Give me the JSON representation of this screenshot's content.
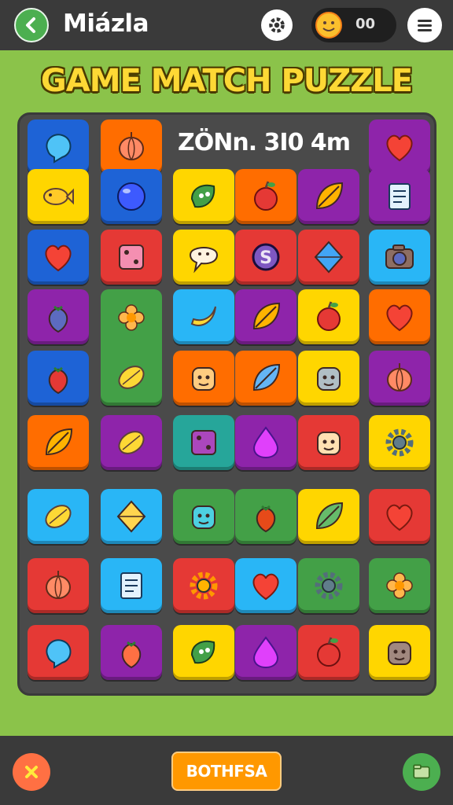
{
  "header": {
    "app_title": "Miázla",
    "coin_count": "00",
    "icons": [
      "back-arrow-icon",
      "gear-icon",
      "coin-face-icon",
      "hamburger-menu-icon"
    ]
  },
  "game": {
    "title": "GAME MATCH PUZZLE",
    "stats_text": "ZÖNn. 3I0  4m"
  },
  "footer": {
    "action_label": "BOTHFSA",
    "icons": [
      "close-x-icon",
      "folder-icon"
    ]
  },
  "colors": {
    "background": "#8bc34a",
    "bar": "#3a3a3a",
    "board": "#4a4a4a",
    "title_yellow": "#fdd835",
    "blue": "#1e63d6",
    "orange": "#ff6d00",
    "red": "#e53935",
    "yellow": "#ffd600",
    "purple": "#8e24aa",
    "green": "#43a047",
    "cyan": "#29b6f6",
    "teal": "#26a69a"
  },
  "tiles": [
    {
      "id": "r0c0",
      "color": "blue",
      "icon": "blob-icon"
    },
    {
      "id": "r0c1",
      "color": "orange",
      "icon": "onion-icon"
    },
    {
      "id": "r0c5",
      "color": "purple",
      "icon": "heart-icon"
    },
    {
      "id": "r1c0",
      "color": "yellow",
      "icon": "fish-icon"
    },
    {
      "id": "r1c1",
      "color": "blue",
      "icon": "orb-icon"
    },
    {
      "id": "r1c2",
      "color": "yellow",
      "icon": "leaf-creature-icon"
    },
    {
      "id": "r1c3",
      "color": "orange",
      "icon": "apple-icon"
    },
    {
      "id": "r1c4",
      "color": "purple",
      "icon": "leaf-icon"
    },
    {
      "id": "r1c5",
      "color": "purple",
      "icon": "paper-icon"
    },
    {
      "id": "r2c0",
      "color": "blue",
      "icon": "heart-icon"
    },
    {
      "id": "r2c1",
      "color": "red",
      "icon": "die-icon"
    },
    {
      "id": "r2c2",
      "color": "yellow",
      "icon": "speech-bubble-icon"
    },
    {
      "id": "r2c3",
      "color": "red",
      "icon": "coin-s-icon"
    },
    {
      "id": "r2c4",
      "color": "red",
      "icon": "gem-bar-icon"
    },
    {
      "id": "r2c5",
      "color": "cyan",
      "icon": "camera-icon"
    },
    {
      "id": "r3c0",
      "color": "purple",
      "icon": "blue-fruit-icon"
    },
    {
      "id": "r3c1",
      "color": "green",
      "icon": "flower-and-leaf-icon"
    },
    {
      "id": "r3c2",
      "color": "cyan",
      "icon": "banana-icon"
    },
    {
      "id": "r3c3",
      "color": "purple",
      "icon": "leaf-icon"
    },
    {
      "id": "r3c4",
      "color": "yellow",
      "icon": "apple-icon"
    },
    {
      "id": "r3c5",
      "color": "orange",
      "icon": "heart-icon"
    },
    {
      "id": "r4c0",
      "color": "blue",
      "icon": "strawberry-icon"
    },
    {
      "id": "r4c2",
      "color": "orange",
      "icon": "cat-face-icon"
    },
    {
      "id": "r4c3",
      "color": "orange",
      "icon": "feather-icon"
    },
    {
      "id": "r4c4",
      "color": "yellow",
      "icon": "robot-icon"
    },
    {
      "id": "r4c5",
      "color": "purple",
      "icon": "onion-icon"
    },
    {
      "id": "r5c0",
      "color": "orange",
      "icon": "leaf-icon"
    },
    {
      "id": "r5c1",
      "color": "purple",
      "icon": "lemon-icon"
    },
    {
      "id": "r5c2",
      "color": "teal",
      "icon": "box-icon"
    },
    {
      "id": "r5c3",
      "color": "purple",
      "icon": "pink-drop-icon"
    },
    {
      "id": "r5c4",
      "color": "red",
      "icon": "mushroom-face-icon"
    },
    {
      "id": "r5c5",
      "color": "yellow",
      "icon": "gear-icon"
    },
    {
      "id": "r6c0",
      "color": "cyan",
      "icon": "lemon-icon"
    },
    {
      "id": "r6c1",
      "color": "cyan",
      "icon": "diamond-icon"
    },
    {
      "id": "r6c2",
      "color": "green",
      "icon": "alien-face-icon"
    },
    {
      "id": "r6c3",
      "color": "green",
      "icon": "pepper-icon"
    },
    {
      "id": "r6c4",
      "color": "yellow",
      "icon": "green-leaf-icon"
    },
    {
      "id": "r6c5",
      "color": "red",
      "icon": "heart-icon"
    },
    {
      "id": "r7c0",
      "color": "red",
      "icon": "onion-icon"
    },
    {
      "id": "r7c1",
      "color": "cyan",
      "icon": "notepad-icon"
    },
    {
      "id": "r7c2",
      "color": "red",
      "icon": "sun-gear-icon"
    },
    {
      "id": "r7c3",
      "color": "cyan",
      "icon": "heart-icon"
    },
    {
      "id": "r7c4",
      "color": "green",
      "icon": "gear-icon"
    },
    {
      "id": "r7c5",
      "color": "green",
      "icon": "flower-icon"
    },
    {
      "id": "r8c0",
      "color": "red",
      "icon": "bubble-icon"
    },
    {
      "id": "r8c1",
      "color": "purple",
      "icon": "orange-fruit-icon"
    },
    {
      "id": "r8c2",
      "color": "yellow",
      "icon": "leaf-creature-icon"
    },
    {
      "id": "r8c3",
      "color": "purple",
      "icon": "pink-drop-icon"
    },
    {
      "id": "r8c4",
      "color": "red",
      "icon": "apple-icon"
    },
    {
      "id": "r8c5",
      "color": "yellow",
      "icon": "cowboy-face-icon"
    }
  ]
}
